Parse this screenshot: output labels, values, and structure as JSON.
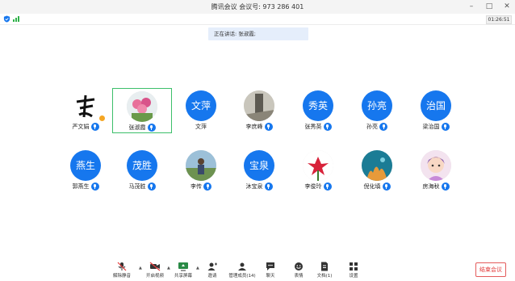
{
  "window": {
    "title": "腾讯会议  会议号:  973 286 401",
    "timer": "01:26:51"
  },
  "speaking": {
    "text": "正在讲话: 张淑霞;"
  },
  "participants": [
    {
      "name": "严文娟",
      "avatar_kind": "image",
      "avatar_desc": "calligraphy logo",
      "mic": true,
      "badge": true
    },
    {
      "name": "张淑霞",
      "avatar_kind": "image",
      "avatar_desc": "pink flowers",
      "mic": true,
      "active": true
    },
    {
      "name": "文萍",
      "avatar_kind": "text",
      "avatar_text": "文萍",
      "mic": false
    },
    {
      "name": "李庶峰",
      "avatar_kind": "image",
      "avatar_desc": "tree photo",
      "mic": true
    },
    {
      "name": "张秀英",
      "avatar_kind": "text",
      "avatar_text": "秀英",
      "mic": true
    },
    {
      "name": "孙亮",
      "avatar_kind": "text",
      "avatar_text": "孙亮",
      "mic": true
    },
    {
      "name": "梁治国",
      "avatar_kind": "text",
      "avatar_text": "治国",
      "mic": true
    },
    {
      "name": "郭燕生",
      "avatar_kind": "text",
      "avatar_text": "燕生",
      "mic": true
    },
    {
      "name": "马茂胜",
      "avatar_kind": "text",
      "avatar_text": "茂胜",
      "mic": true
    },
    {
      "name": "李传",
      "avatar_kind": "image",
      "avatar_desc": "person outdoors",
      "mic": true
    },
    {
      "name": "沐宝泉",
      "avatar_kind": "text",
      "avatar_text": "宝泉",
      "mic": true
    },
    {
      "name": "李俊玲",
      "avatar_kind": "image",
      "avatar_desc": "red lily",
      "mic": true
    },
    {
      "name": "倪化填",
      "avatar_kind": "image",
      "avatar_desc": "coral reef",
      "mic": true
    },
    {
      "name": "房海秋",
      "avatar_kind": "image",
      "avatar_desc": "cartoon girl",
      "mic": true
    }
  ],
  "toolbar": {
    "items": [
      {
        "label": "解除静音",
        "icon": "mic-muted-icon"
      },
      {
        "label": "开启视频",
        "icon": "video-off-icon"
      },
      {
        "label": "共享屏幕",
        "icon": "share-screen-icon"
      },
      {
        "label": "邀请",
        "icon": "invite-icon"
      },
      {
        "label": "管理成员(14)",
        "icon": "members-icon"
      },
      {
        "label": "聊天",
        "icon": "chat-icon"
      },
      {
        "label": "表情",
        "icon": "emoji-icon"
      },
      {
        "label": "文档(1)",
        "icon": "document-icon"
      },
      {
        "label": "设置",
        "icon": "settings-icon"
      }
    ],
    "end_label": "结束会议"
  },
  "colors": {
    "accent": "#1677ee",
    "active_border": "#3cbf6a",
    "end": "#e23c3c"
  }
}
